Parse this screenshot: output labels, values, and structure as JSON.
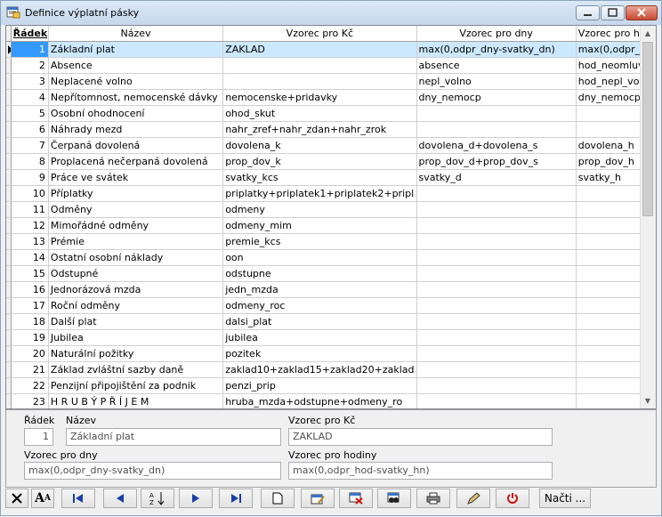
{
  "window": {
    "title": "Definice výplatní pásky"
  },
  "grid": {
    "headers": {
      "radek": "Řádek",
      "nazev": "Název",
      "kc": "Vzorec pro Kč",
      "dny": "Vzorec pro dny",
      "hodiny": "Vzorec pro h"
    },
    "rows": [
      {
        "n": "1",
        "nazev": "Základní plat",
        "kc": "ZAKLAD",
        "dny": "max(0,odpr_dny-svatky_dn)",
        "hod": "max(0,odpr_"
      },
      {
        "n": "2",
        "nazev": "Absence",
        "kc": "",
        "dny": "absence",
        "hod": "hod_neomluv"
      },
      {
        "n": "3",
        "nazev": "Neplacené volno",
        "kc": "",
        "dny": "nepl_volno",
        "hod": "hod_nepl_vol"
      },
      {
        "n": "4",
        "nazev": "Nepřítomnost, nemocenské dávky",
        "kc": "nemocenske+pridavky",
        "dny": "dny_nemocp",
        "hod": "dny_nemocp"
      },
      {
        "n": "5",
        "nazev": "Osobní ohodnocení",
        "kc": "ohod_skut",
        "dny": "",
        "hod": ""
      },
      {
        "n": "6",
        "nazev": "Náhrady mezd",
        "kc": "nahr_zref+nahr_zdan+nahr_zrok",
        "dny": "",
        "hod": ""
      },
      {
        "n": "7",
        "nazev": "Čerpaná dovolená",
        "kc": "dovolena_k",
        "dny": "dovolena_d+dovolena_s",
        "hod": "dovolena_h"
      },
      {
        "n": "8",
        "nazev": "Proplacená nečerpaná dovolená",
        "kc": "prop_dov_k",
        "dny": "prop_dov_d+prop_dov_s",
        "hod": "prop_dov_h"
      },
      {
        "n": "9",
        "nazev": "Práce ve svátek",
        "kc": "svatky_kcs",
        "dny": "svatky_d",
        "hod": "svatky_h"
      },
      {
        "n": "10",
        "nazev": "Příplatky",
        "kc": "priplatky+priplatek1+priplatek2+pripl",
        "dny": "",
        "hod": ""
      },
      {
        "n": "11",
        "nazev": "Odměny",
        "kc": "odmeny",
        "dny": "",
        "hod": ""
      },
      {
        "n": "12",
        "nazev": "Mimořádné odměny",
        "kc": "odmeny_mim",
        "dny": "",
        "hod": ""
      },
      {
        "n": "13",
        "nazev": "Prémie",
        "kc": "premie_kcs",
        "dny": "",
        "hod": ""
      },
      {
        "n": "14",
        "nazev": "Ostatní osobní náklady",
        "kc": "oon",
        "dny": "",
        "hod": ""
      },
      {
        "n": "15",
        "nazev": "Odstupné",
        "kc": "odstupne",
        "dny": "",
        "hod": ""
      },
      {
        "n": "16",
        "nazev": "Jednorázová mzda",
        "kc": "jedn_mzda",
        "dny": "",
        "hod": ""
      },
      {
        "n": "17",
        "nazev": "Roční odměny",
        "kc": "odmeny_roc",
        "dny": "",
        "hod": ""
      },
      {
        "n": "18",
        "nazev": "Další plat",
        "kc": "dalsi_plat",
        "dny": "",
        "hod": ""
      },
      {
        "n": "19",
        "nazev": "Jubilea",
        "kc": "jubilea",
        "dny": "",
        "hod": ""
      },
      {
        "n": "20",
        "nazev": "Naturální požitky",
        "kc": "pozitek",
        "dny": "",
        "hod": ""
      },
      {
        "n": "21",
        "nazev": "Základ zvláštní sazby daně",
        "kc": "zaklad10+zaklad15+zaklad20+zaklad",
        "dny": "",
        "hod": ""
      },
      {
        "n": "22",
        "nazev": "Penzijní připojištění za podnik",
        "kc": "penzi_prip",
        "dny": "",
        "hod": ""
      },
      {
        "n": "23",
        "nazev": "H R U B Ý   P Ř Í J E M",
        "kc": "hruba_mzda+odstupne+odmeny_ro",
        "dny": "",
        "hod": ""
      }
    ]
  },
  "detail": {
    "radek_label": "Řádek",
    "radek_value": "1",
    "nazev_label": "Název",
    "nazev_value": "Základní plat",
    "kc_label": "Vzorec pro Kč",
    "kc_value": "ZAKLAD",
    "dny_label": "Vzorec pro dny",
    "dny_value": "max(0,odpr_dny-svatky_dn)",
    "hod_label": "Vzorec pro hodiny",
    "hod_value": "max(0,odpr_hod-svatky_hn)"
  },
  "toolbar": {
    "nacti": "Načti ..."
  }
}
